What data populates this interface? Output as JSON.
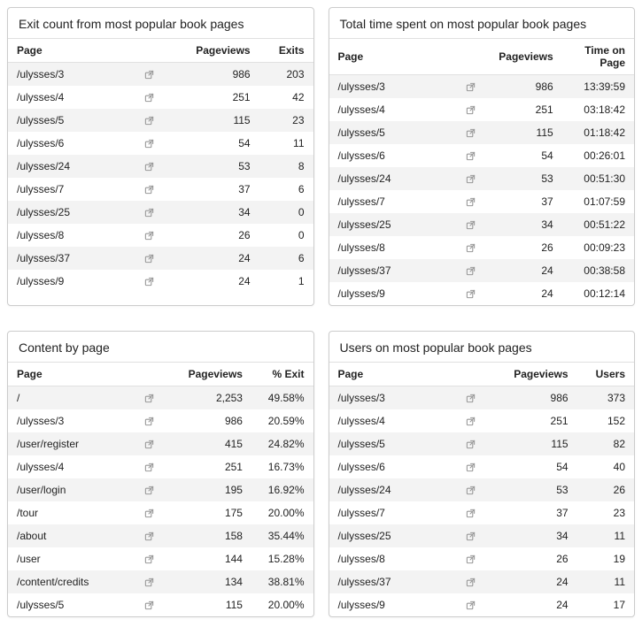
{
  "panels": [
    {
      "title": "Exit count from most popular book pages",
      "columns": [
        "Page",
        "",
        "Pageviews",
        "Exits"
      ],
      "col_align": [
        "left",
        "left",
        "right",
        "right"
      ],
      "rows": [
        [
          "/ulysses/3",
          "icon",
          "986",
          "203"
        ],
        [
          "/ulysses/4",
          "icon",
          "251",
          "42"
        ],
        [
          "/ulysses/5",
          "icon",
          "115",
          "23"
        ],
        [
          "/ulysses/6",
          "icon",
          "54",
          "11"
        ],
        [
          "/ulysses/24",
          "icon",
          "53",
          "8"
        ],
        [
          "/ulysses/7",
          "icon",
          "37",
          "6"
        ],
        [
          "/ulysses/25",
          "icon",
          "34",
          "0"
        ],
        [
          "/ulysses/8",
          "icon",
          "26",
          "0"
        ],
        [
          "/ulysses/37",
          "icon",
          "24",
          "6"
        ],
        [
          "/ulysses/9",
          "icon",
          "24",
          "1"
        ]
      ]
    },
    {
      "title": "Total time spent on most popular book pages",
      "columns": [
        "Page",
        "",
        "Pageviews",
        "Time on Page"
      ],
      "col_align": [
        "left",
        "left",
        "right",
        "right"
      ],
      "rows": [
        [
          "/ulysses/3",
          "icon",
          "986",
          "13:39:59"
        ],
        [
          "/ulysses/4",
          "icon",
          "251",
          "03:18:42"
        ],
        [
          "/ulysses/5",
          "icon",
          "115",
          "01:18:42"
        ],
        [
          "/ulysses/6",
          "icon",
          "54",
          "00:26:01"
        ],
        [
          "/ulysses/24",
          "icon",
          "53",
          "00:51:30"
        ],
        [
          "/ulysses/7",
          "icon",
          "37",
          "01:07:59"
        ],
        [
          "/ulysses/25",
          "icon",
          "34",
          "00:51:22"
        ],
        [
          "/ulysses/8",
          "icon",
          "26",
          "00:09:23"
        ],
        [
          "/ulysses/37",
          "icon",
          "24",
          "00:38:58"
        ],
        [
          "/ulysses/9",
          "icon",
          "24",
          "00:12:14"
        ]
      ]
    },
    {
      "title": "Content by page",
      "columns": [
        "Page",
        "",
        "Pageviews",
        "% Exit"
      ],
      "col_align": [
        "left",
        "left",
        "right",
        "right"
      ],
      "rows": [
        [
          "/",
          "icon",
          "2,253",
          "49.58%"
        ],
        [
          "/ulysses/3",
          "icon",
          "986",
          "20.59%"
        ],
        [
          "/user/register",
          "icon",
          "415",
          "24.82%"
        ],
        [
          "/ulysses/4",
          "icon",
          "251",
          "16.73%"
        ],
        [
          "/user/login",
          "icon",
          "195",
          "16.92%"
        ],
        [
          "/tour",
          "icon",
          "175",
          "20.00%"
        ],
        [
          "/about",
          "icon",
          "158",
          "35.44%"
        ],
        [
          "/user",
          "icon",
          "144",
          "15.28%"
        ],
        [
          "/content/credits",
          "icon",
          "134",
          "38.81%"
        ],
        [
          "/ulysses/5",
          "icon",
          "115",
          "20.00%"
        ]
      ]
    },
    {
      "title": "Users on most popular book pages",
      "columns": [
        "Page",
        "",
        "Pageviews",
        "Users"
      ],
      "col_align": [
        "left",
        "left",
        "right",
        "right"
      ],
      "rows": [
        [
          "/ulysses/3",
          "icon",
          "986",
          "373"
        ],
        [
          "/ulysses/4",
          "icon",
          "251",
          "152"
        ],
        [
          "/ulysses/5",
          "icon",
          "115",
          "82"
        ],
        [
          "/ulysses/6",
          "icon",
          "54",
          "40"
        ],
        [
          "/ulysses/24",
          "icon",
          "53",
          "26"
        ],
        [
          "/ulysses/7",
          "icon",
          "37",
          "23"
        ],
        [
          "/ulysses/25",
          "icon",
          "34",
          "11"
        ],
        [
          "/ulysses/8",
          "icon",
          "26",
          "19"
        ],
        [
          "/ulysses/37",
          "icon",
          "24",
          "11"
        ],
        [
          "/ulysses/9",
          "icon",
          "24",
          "17"
        ]
      ]
    }
  ]
}
